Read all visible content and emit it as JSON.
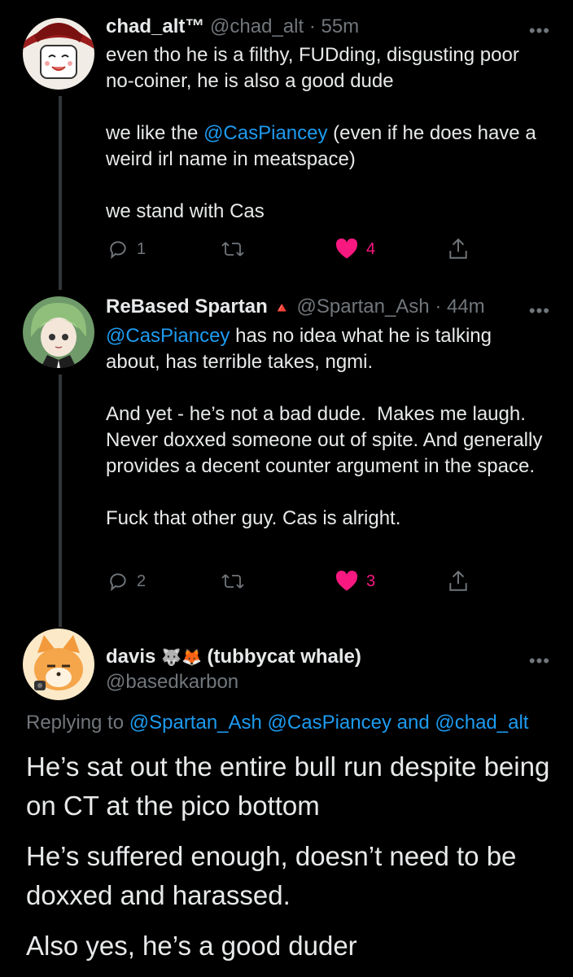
{
  "tweets": [
    {
      "name": "chad_alt™",
      "handle": "@chad_alt",
      "time": "· 55m",
      "text_parts": [
        "even tho he is a filthy, FUDding, disgusting poor no-coiner, he is also a good dude\n\nwe like the ",
        "@CasPiancey",
        " (even if he does have a weird irl name in meatspace)\n\nwe stand with Cas"
      ],
      "reply_count": "1",
      "retweet_count": "",
      "like_count": "4"
    },
    {
      "name": "ReBased Spartan",
      "name_badge": "🔺",
      "handle": "@Spartan_Ash",
      "time": "· 44m",
      "text_parts": [
        "@CasPiancey",
        " has no idea what he is talking about, has terrible takes, ngmi.\n\nAnd yet - he’s not a bad dude.  Makes me laugh. Never doxxed someone out of spite. And generally provides a decent counter argument in the space.\n\nFuck that other guy. Cas is alright."
      ],
      "reply_count": "2",
      "retweet_count": "",
      "like_count": "3"
    }
  ],
  "main_tweet": {
    "name": "davis",
    "name_suffix": "(tubbycat whale)",
    "name_emojis": "🐺🦊",
    "handle": "@basedkarbon",
    "replying_label": "Replying to ",
    "replying_mentions": [
      "@Spartan_Ash",
      "@CasPiancey",
      "@chad_alt"
    ],
    "replying_and": " and ",
    "paragraphs": [
      "He’s sat out the entire bull run despite being on CT at the pico bottom",
      "He’s suffered enough, doesn’t need to be doxxed and harassed.",
      "Also yes, he’s a good duder"
    ]
  },
  "more_label": "•••",
  "colors": {
    "background": "#000000",
    "text": "#e7e9ea",
    "muted": "#71767b",
    "link": "#1d9bf0",
    "like": "#f91880",
    "thread": "#333639"
  },
  "icons": [
    "reply-icon",
    "retweet-icon",
    "heart-icon",
    "share-icon",
    "more-icon"
  ]
}
